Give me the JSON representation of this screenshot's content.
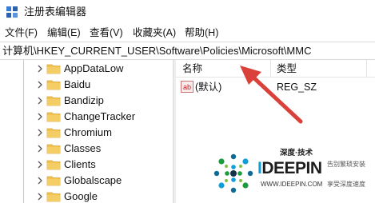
{
  "window": {
    "title": "注册表编辑器",
    "icon": "regedit-icon"
  },
  "menu": {
    "items": [
      {
        "label": "文件(F)"
      },
      {
        "label": "编辑(E)"
      },
      {
        "label": "查看(V)"
      },
      {
        "label": "收藏夹(A)"
      },
      {
        "label": "帮助(H)"
      }
    ]
  },
  "address": {
    "path": "计算机\\HKEY_CURRENT_USER\\Software\\Policies\\Microsoft\\MMC"
  },
  "tree": {
    "items": [
      {
        "label": "AppDataLow"
      },
      {
        "label": "Baidu"
      },
      {
        "label": "Bandizip"
      },
      {
        "label": "ChangeTracker"
      },
      {
        "label": "Chromium"
      },
      {
        "label": "Classes"
      },
      {
        "label": "Clients"
      },
      {
        "label": "Globalscape"
      },
      {
        "label": "Google"
      }
    ]
  },
  "list": {
    "columns": {
      "name": "名称",
      "type": "类型"
    },
    "rows": [
      {
        "icon": "string-value-icon",
        "name": "(默认)",
        "type": "REG_SZ"
      }
    ]
  },
  "annotation": {
    "arrow_color": "#d9413a"
  },
  "watermark": {
    "chinese_brand": "深度·技术",
    "brand_prefix": "I",
    "brand_main": "DEEPIN",
    "slogan_top": "告别繁琐安装",
    "url": "WWW.IDEEPIN.COM",
    "slogan_bottom": "享受深度速度"
  },
  "colors": {
    "folder": "#f2c14e",
    "folder_dark": "#dba73a",
    "watermark_accent": "#0f9ed8"
  }
}
